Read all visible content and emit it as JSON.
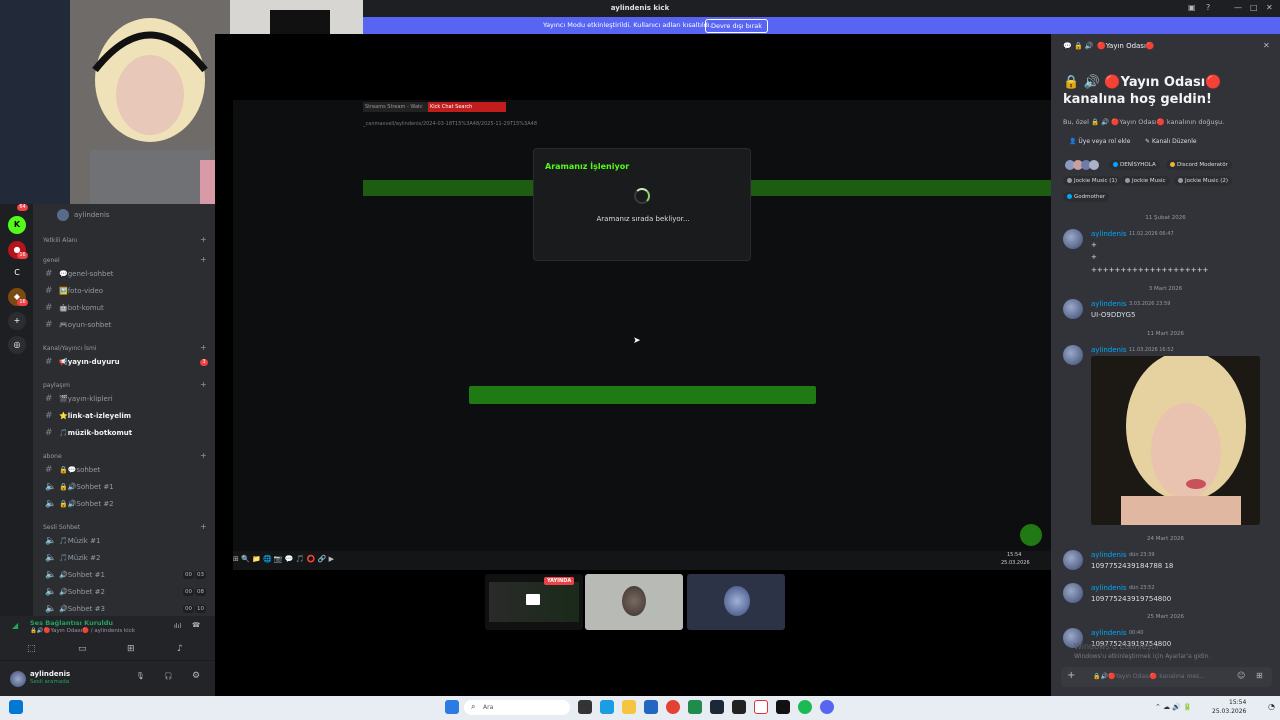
{
  "window": {
    "title": "aylindenis kick"
  },
  "banner": {
    "text": "Yayıncı Modu etkinleştirildi. Kullanıcı adları kısaltıldı.",
    "button": "Devre dışı bırak"
  },
  "sidebar": {
    "server_name": "aylindenis",
    "categories": [
      {
        "label": "Yetkili Alanı"
      },
      {
        "label": "genel"
      },
      {
        "label": "Kanal/Yayıncı İsmi"
      },
      {
        "label": "paylaşım"
      },
      {
        "label": "abone"
      },
      {
        "label": "Sesli Sohbet"
      }
    ],
    "channels": [
      {
        "name": "💬genel-sohbet"
      },
      {
        "name": "🖼️foto-video"
      },
      {
        "name": "🤖bot-komut"
      },
      {
        "name": "🎮oyun-sohbet"
      },
      {
        "name": "📢yayın-duyuru",
        "badge": "3"
      },
      {
        "name": "🎬yayın-klipleri"
      },
      {
        "name": "⭐link-at-izleyelim"
      },
      {
        "name": "🎵müzik-botkomut"
      },
      {
        "name": "🔒💬sohbet"
      },
      {
        "name": "🔒🔊Sohbet #1"
      },
      {
        "name": "🔒🔊Sohbet #2"
      },
      {
        "name": "🎵Müzik #1"
      },
      {
        "name": "🎵Müzik #2"
      },
      {
        "name": "🔊Sohbet #1",
        "c1": "00",
        "c2": "03"
      },
      {
        "name": "🔊Sohbet #2",
        "c1": "00",
        "c2": "08"
      },
      {
        "name": "🔊Sohbet #3",
        "c1": "00",
        "c2": "10"
      }
    ],
    "rail_badges": [
      "64",
      "16",
      "16"
    ]
  },
  "voice": {
    "status": "Ses Bağlantısı Kuruldu",
    "location": "🔒🔊🔴Yayın Odası🔴 / aylindenis kick"
  },
  "user": {
    "name": "aylindenis",
    "status": "Sesli aramada"
  },
  "stream": {
    "tab_1": "Kick Chat Search",
    "tab_0": "Streams Stream - Watc",
    "url": "_canmaxvell/aylindenis/2024-03-18T15%3A48/2025-11-29T15%3A48",
    "dialog_title": "Aramanız İşleniyor",
    "dialog_text": "Aramanız sırada bekliyor...",
    "clock_time": "15:54",
    "clock_date": "25.03.2026",
    "live_badge": "YAYINDA"
  },
  "chat": {
    "header_channel": "🔴Yayın Odası🔴",
    "welcome_title": "🔒 🔊 🔴Yayın Odası🔴 kanalına hoş geldin!",
    "welcome_sub": "Bu, özel 🔒 🔊 🔴Yayın Odası🔴 kanalının doğuşu.",
    "action_add": "Üye veya rol ekle",
    "action_edit": "Kanalı Düzenle",
    "chips": [
      "DENİSYHOLA",
      "Discord Moderatör",
      "Jockie Music (1)",
      "Jockie Music",
      "Jockie Music (2)",
      "Godmother"
    ],
    "messages": [
      {
        "date": "11 Şubat 2026",
        "author": "aylindenis",
        "time": "11.02.2026 06:47",
        "lines": [
          "+",
          "+",
          "++++++++++++++++++++"
        ]
      },
      {
        "date": "3 Mart 2026",
        "author": "aylindenis",
        "time": "3.03.2026 23:59",
        "lines": [
          "UI-O9DDYG5"
        ]
      },
      {
        "date": "11 Mart 2026",
        "author": "aylindenis",
        "time": "11.03.2026 16:52",
        "lines": []
      },
      {
        "date": "24 Mart 2026",
        "author": "aylindenis",
        "time": "dün 23:39",
        "lines": [
          "1097752439184788 18"
        ]
      },
      {
        "date": "",
        "author": "aylindenis",
        "time": "dün 23:52",
        "lines": [
          "109775243919754800"
        ]
      },
      {
        "date": "25 Mart 2026",
        "author": "aylindenis",
        "time": "00:40",
        "lines": [
          "109775243919754800"
        ]
      }
    ],
    "input_placeholder": "🔒🔊🔴Yayın Odası🔴 kanalına mes...",
    "activation_1": "Windows'u Etkinleştir",
    "activation_2": "Windows'u etkinleştirmek için Ayarlar'a gidin."
  },
  "taskbar": {
    "search": "Ara",
    "time": "15:54",
    "date": "25.03.2026"
  }
}
